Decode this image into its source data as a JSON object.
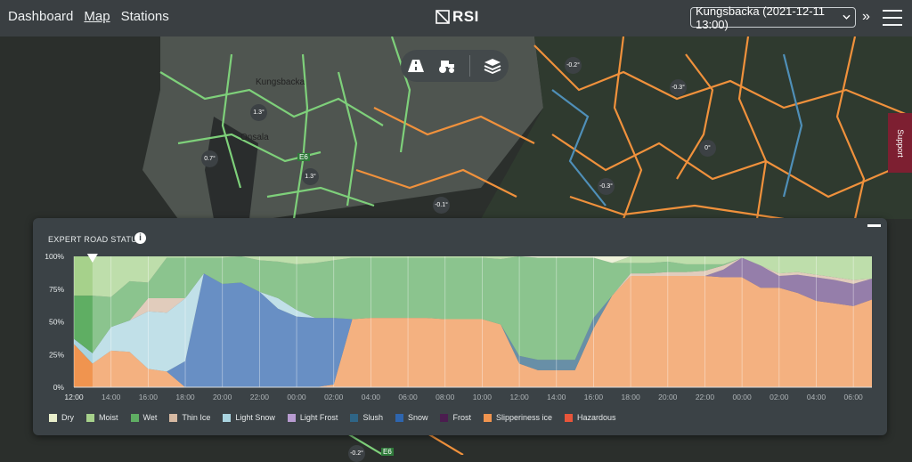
{
  "nav": {
    "dashboard": "Dashboard",
    "map": "Map",
    "stations": "Stations"
  },
  "logo": {
    "text": "RSI"
  },
  "station_select": {
    "value": "Kungsbacka (2021-12-11 13:00)"
  },
  "support": {
    "label": "Support"
  },
  "map_badges": [
    "-0.2°",
    "-0.3°",
    "1.3°",
    "0.7°",
    "1.3°",
    "0°",
    "-0.3°",
    "-0.1°",
    "-0.2°"
  ],
  "map_labels": [
    "Kungsbacka",
    "Onsala",
    "E6",
    "E6"
  ],
  "panel": {
    "title": "EXPERT ROAD STATUS"
  },
  "chart_data": {
    "type": "area",
    "stacked": true,
    "x": [
      "12:00",
      "13:00",
      "14:00",
      "15:00",
      "16:00",
      "17:00",
      "18:00",
      "19:00",
      "20:00",
      "21:00",
      "22:00",
      "23:00",
      "00:00",
      "01:00",
      "02:00",
      "03:00",
      "04:00",
      "05:00",
      "06:00",
      "07:00",
      "08:00",
      "09:00",
      "10:00",
      "11:00",
      "12:00",
      "13:00",
      "14:00",
      "15:00",
      "16:00",
      "17:00",
      "18:00",
      "19:00",
      "20:00",
      "21:00",
      "22:00",
      "23:00",
      "00:00",
      "01:00",
      "02:00",
      "03:00",
      "04:00",
      "05:00",
      "06:00",
      "07:00"
    ],
    "xticks": [
      "12:00",
      "14:00",
      "16:00",
      "18:00",
      "20:00",
      "22:00",
      "00:00",
      "02:00",
      "04:00",
      "06:00",
      "08:00",
      "10:00",
      "12:00",
      "14:00",
      "16:00",
      "18:00",
      "20:00",
      "22:00",
      "00:00",
      "02:00",
      "04:00",
      "06:00"
    ],
    "yticks": [
      "0%",
      "25%",
      "50%",
      "75%",
      "100%"
    ],
    "ylim": [
      0,
      100
    ],
    "forecast_start": "13:00",
    "series": [
      {
        "name": "Hazardous",
        "color": "#e8553a",
        "values": [
          0,
          0,
          0,
          0,
          0,
          0,
          0,
          0,
          0,
          0,
          0,
          0,
          0,
          0,
          0,
          0,
          0,
          0,
          0,
          0,
          0,
          0,
          0,
          0,
          0,
          0,
          0,
          0,
          0,
          0,
          0,
          0,
          0,
          0,
          0,
          0,
          0,
          0,
          0,
          0,
          0,
          0,
          0,
          0
        ]
      },
      {
        "name": "Slipperiness ice",
        "color": "#f0944f",
        "values": [
          33,
          18,
          28,
          27,
          14,
          12,
          0,
          0,
          0,
          0,
          0,
          0,
          0,
          0,
          2,
          52,
          53,
          53,
          53,
          53,
          52,
          52,
          52,
          48,
          18,
          13,
          13,
          13,
          45,
          70,
          85,
          85,
          85,
          85,
          85,
          84,
          84,
          76,
          76,
          72,
          66,
          64,
          62,
          67
        ]
      },
      {
        "name": "Frost",
        "color": "#4b1d4f",
        "values": [
          0,
          0,
          0,
          0,
          0,
          0,
          0,
          0,
          0,
          0,
          0,
          0,
          0,
          0,
          0,
          0,
          0,
          0,
          0,
          0,
          0,
          0,
          0,
          0,
          0,
          0,
          0,
          0,
          0,
          0,
          0,
          0,
          0,
          0,
          0,
          0,
          0,
          0,
          0,
          0,
          0,
          0,
          0,
          0
        ]
      },
      {
        "name": "Snow",
        "color": "#2e65ae",
        "values": [
          0,
          0,
          0,
          0,
          0,
          0,
          20,
          87,
          79,
          80,
          73,
          60,
          54,
          53,
          51,
          0,
          0,
          0,
          0,
          0,
          0,
          0,
          0,
          0,
          0,
          0,
          0,
          0,
          0,
          0,
          0,
          0,
          0,
          0,
          0,
          0,
          0,
          0,
          0,
          0,
          0,
          0,
          0,
          0
        ]
      },
      {
        "name": "Slush",
        "color": "#2f6586",
        "values": [
          0,
          0,
          0,
          0,
          0,
          0,
          0,
          0,
          0,
          0,
          0,
          0,
          0,
          0,
          0,
          0,
          0,
          0,
          0,
          0,
          0,
          0,
          0,
          0,
          6,
          8,
          8,
          8,
          8,
          0,
          0,
          0,
          0,
          0,
          0,
          0,
          0,
          0,
          0,
          0,
          0,
          0,
          0,
          0
        ]
      },
      {
        "name": "Light Frost",
        "color": "#6d4d8a",
        "values": [
          0,
          0,
          0,
          0,
          0,
          0,
          0,
          0,
          0,
          0,
          0,
          0,
          0,
          0,
          0,
          0,
          0,
          0,
          0,
          0,
          0,
          0,
          0,
          0,
          0,
          0,
          0,
          0,
          0,
          0,
          0,
          0,
          0,
          0,
          0,
          6,
          15,
          17,
          9,
          14,
          18,
          18,
          17,
          16
        ]
      },
      {
        "name": "Light Snow",
        "color": "#a9d4e0",
        "values": [
          4,
          8,
          18,
          24,
          44,
          45,
          48,
          0,
          0,
          0,
          0,
          8,
          5,
          0,
          0,
          0,
          0,
          0,
          0,
          0,
          0,
          0,
          0,
          0,
          0,
          0,
          0,
          0,
          0,
          0,
          0,
          0,
          0,
          0,
          0,
          0,
          0,
          0,
          0,
          0,
          0,
          0,
          0,
          0
        ]
      },
      {
        "name": "Thin Ice",
        "color": "#d6b9a2",
        "values": [
          0,
          0,
          0,
          0,
          10,
          11,
          0,
          0,
          0,
          0,
          0,
          0,
          0,
          0,
          0,
          0,
          0,
          0,
          0,
          0,
          0,
          0,
          0,
          0,
          0,
          0,
          0,
          0,
          0,
          0,
          2,
          2,
          3,
          3,
          4,
          3,
          0,
          0,
          2,
          2,
          2,
          2,
          3,
          0
        ]
      },
      {
        "name": "Wet",
        "color": "#5fae63",
        "values": [
          33,
          44,
          23,
          30,
          12,
          31,
          31,
          12,
          20,
          20,
          24,
          28,
          35,
          42,
          44,
          47,
          46,
          46,
          46,
          46,
          47,
          47,
          47,
          50,
          76,
          78,
          78,
          78,
          46,
          25,
          8,
          8,
          8,
          6,
          5,
          1,
          0,
          0,
          0,
          0,
          0,
          0,
          0,
          0
        ]
      },
      {
        "name": "Moist",
        "color": "#a6d18b",
        "values": [
          30,
          30,
          31,
          19,
          20,
          1,
          1,
          1,
          1,
          0,
          3,
          4,
          6,
          5,
          3,
          1,
          1,
          1,
          1,
          1,
          1,
          1,
          1,
          2,
          0,
          0,
          0,
          0,
          0,
          0,
          5,
          5,
          4,
          6,
          6,
          6,
          1,
          7,
          13,
          12,
          14,
          16,
          18,
          17
        ]
      },
      {
        "name": "Dry",
        "color": "#e8eecb",
        "values": [
          0,
          0,
          0,
          0,
          0,
          0,
          0,
          0,
          0,
          0,
          0,
          0,
          0,
          0,
          0,
          0,
          0,
          0,
          0,
          0,
          0,
          0,
          0,
          0,
          0,
          1,
          1,
          1,
          1,
          5,
          0,
          0,
          0,
          0,
          0,
          0,
          0,
          0,
          0,
          0,
          0,
          0,
          0,
          0
        ]
      }
    ]
  },
  "legend": [
    "Dry",
    "Moist",
    "Wet",
    "Thin Ice",
    "Light Snow",
    "Light Frost",
    "Slush",
    "Snow",
    "Frost",
    "Slipperiness ice",
    "Hazardous"
  ],
  "legend_colors": [
    "#e8eecb",
    "#a6d18b",
    "#5fae63",
    "#d6b9a2",
    "#a9d4e0",
    "#b79bd0",
    "#2f6586",
    "#2e65ae",
    "#4b1d4f",
    "#f0944f",
    "#e8553a"
  ]
}
